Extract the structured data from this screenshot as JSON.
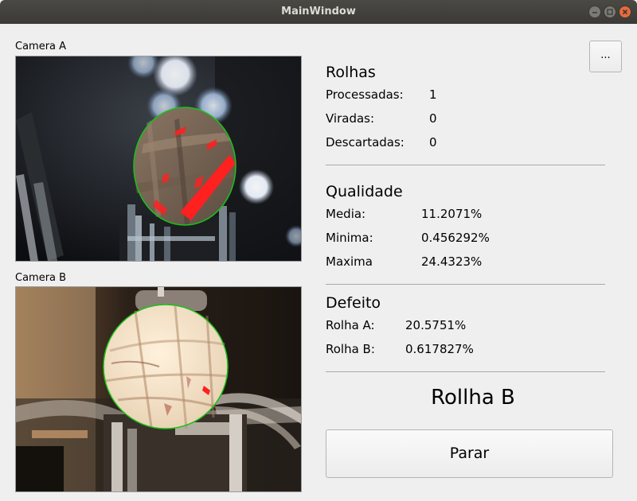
{
  "window": {
    "title": "MainWindow"
  },
  "camera_a": {
    "label": "Camera A"
  },
  "camera_b": {
    "label": "Camera B"
  },
  "menu_button": {
    "label": "..."
  },
  "rolhas": {
    "title": "Rolhas",
    "rows": [
      {
        "label": "Processadas:",
        "value": "1"
      },
      {
        "label": "Viradas:",
        "value": "0"
      },
      {
        "label": "Descartadas:",
        "value": "0"
      }
    ]
  },
  "qualidade": {
    "title": "Qualidade",
    "rows": [
      {
        "label": "Media:",
        "value": "11.2071%"
      },
      {
        "label": "Minima:",
        "value": "0.456292%"
      },
      {
        "label": "Maxima",
        "value": "24.4323%"
      }
    ]
  },
  "defeito": {
    "title": "Defeito",
    "rows": [
      {
        "label": "Rolha A:",
        "value": "20.5751%"
      },
      {
        "label": "Rolha B:",
        "value": "0.617827%"
      }
    ]
  },
  "current_status": "Rollha B",
  "stop_button": {
    "label": "Parar"
  },
  "colors": {
    "defect_overlay": "#ff2020",
    "detection_circle": "#19c219",
    "titlebar": "#3e3d39",
    "close_button": "#e86a3d"
  }
}
